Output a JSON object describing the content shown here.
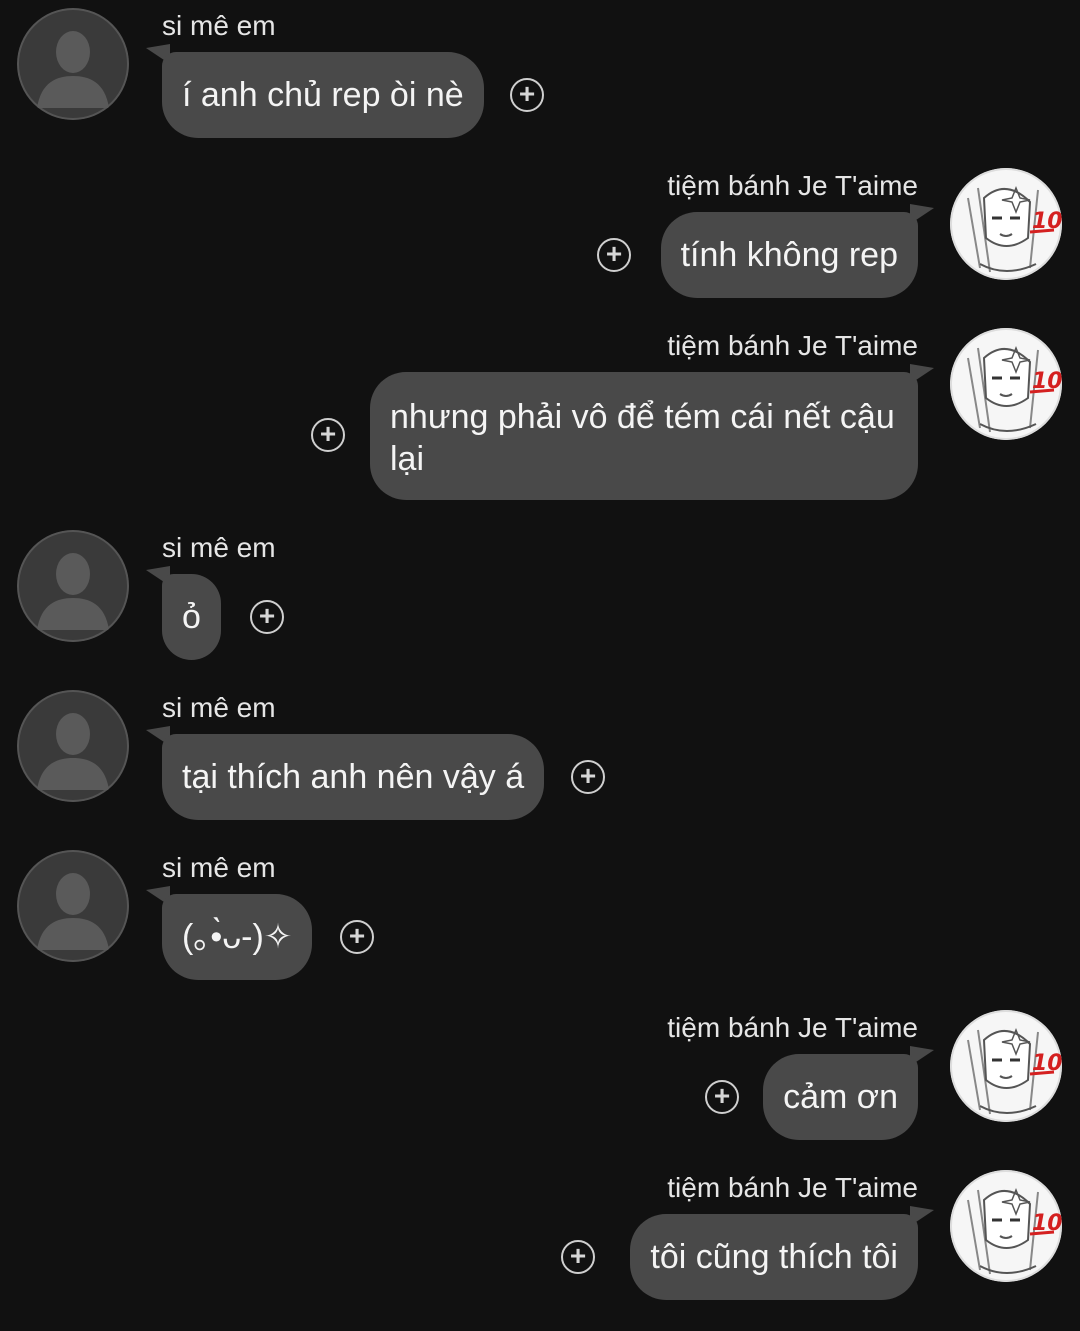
{
  "contacts": {
    "other": {
      "name": "si mê em",
      "avatar_icon": "default-person-silhouette-icon"
    },
    "self": {
      "name": "tiệm bánh Je T'aime",
      "avatar_icon": "manga-girl-avatar-icon",
      "badge": "10"
    }
  },
  "messages": [
    {
      "side": "left",
      "sender": "si mê em",
      "text": "í anh chủ rep òi nè"
    },
    {
      "side": "right",
      "sender": "tiệm bánh Je T'aime",
      "text": "tính không rep"
    },
    {
      "side": "right",
      "sender": "tiệm bánh Je T'aime",
      "text": "nhưng phải vô để tém cái nết cậu lại"
    },
    {
      "side": "left",
      "sender": "si mê em",
      "text": "ỏ"
    },
    {
      "side": "left",
      "sender": "si mê em",
      "text": "tại thích anh nên vậy á"
    },
    {
      "side": "left",
      "sender": "si mê em",
      "text": "(｡•̀ᴗ-)✧"
    },
    {
      "side": "right",
      "sender": "tiệm bánh Je T'aime",
      "text": "cảm ơn"
    },
    {
      "side": "right",
      "sender": "tiệm bánh Je T'aime",
      "text": "tôi cũng thích tôi"
    }
  ],
  "react_icon": "add-reaction-icon",
  "colors": {
    "background": "#111111",
    "bubble": "#494949",
    "text": "#f4f4f4"
  }
}
